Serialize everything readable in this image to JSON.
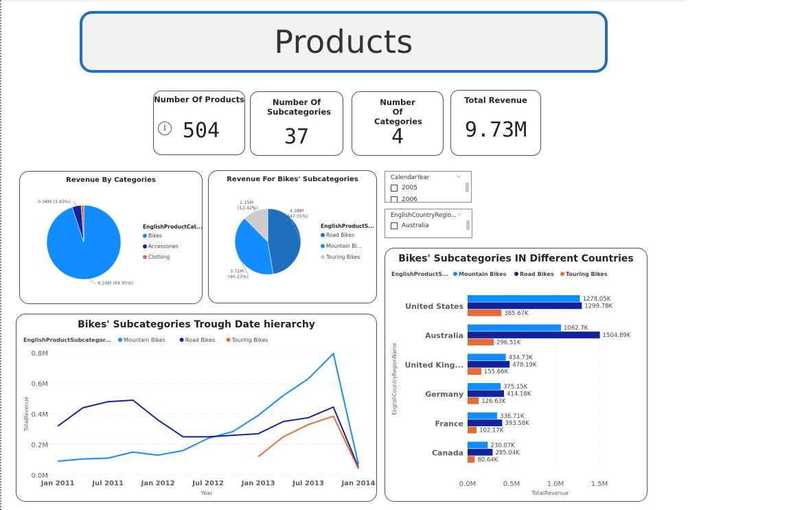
{
  "header": {
    "title": "Products"
  },
  "kpis": {
    "products": {
      "label": "Number Of Products",
      "value": "504"
    },
    "subcategories": {
      "label": "Number Of Subcategories",
      "value": "37"
    },
    "categories": {
      "label": "Number Of Categories",
      "value": "4"
    },
    "revenue": {
      "label": "Total Revenue",
      "value": "9.73M"
    }
  },
  "slicers": {
    "year": {
      "header": "CalendarYear",
      "items": [
        "2005",
        "2006"
      ]
    },
    "country": {
      "header": "EnglishCountryRegio...",
      "items": [
        "Australia"
      ]
    }
  },
  "colors": {
    "mountain": "#118DFF",
    "road": "#12239E",
    "touring": "#E66C37",
    "light_gray": "#CCCCCC",
    "border_blue": "#1F6FBF"
  },
  "chart_data": [
    {
      "type": "pie",
      "title": "Revenue By Categories",
      "legend_title": "EnglishProductCat...",
      "legend_position": "right",
      "labels": [
        "Bikes",
        "Accessories",
        "Clothing"
      ],
      "values": [
        9.24,
        0.38,
        0.11
      ],
      "colors": [
        "#118DFF",
        "#12239E",
        "#E66C37"
      ],
      "data_labels": [
        "9.24M (94.95%)",
        "0.38M (3.93%)",
        ""
      ]
    },
    {
      "type": "pie",
      "title": "Revenue For Bikes' Subcategories",
      "legend_title": "EnglishProductS...",
      "legend_position": "right",
      "labels": [
        "Road Bikes",
        "Mountain Bi...",
        "Touring Bikes"
      ],
      "values": [
        4.38,
        3.72,
        1.15
      ],
      "colors": [
        "#1F6FBF",
        "#118DFF",
        "#CCCCCC"
      ],
      "data_labels": [
        [
          "4.38M",
          "(47.35%)"
        ],
        [
          "3.72M",
          "(40.23%)"
        ],
        [
          "1.15M",
          "(12.42%)"
        ]
      ]
    },
    {
      "type": "line",
      "title": "Bikes' Subcategories Trough Date hierarchy",
      "legend_title": "EnglishProductSubcategor...",
      "xlabel": "Year",
      "ylabel": "TotalRevenue",
      "x_ticks": [
        "Jan 2011",
        "Jul 2011",
        "Jan 2012",
        "Jul 2012",
        "Jan 2013",
        "Jul 2013",
        "Jan 2014"
      ],
      "y_ticks": [
        "0.0M",
        "0.2M",
        "0.4M",
        "0.6M",
        "0.8M"
      ],
      "ylim": [
        0,
        0.8
      ],
      "grid": true,
      "x_months": [
        "2010-12",
        "2011-01",
        "2011-02",
        "2011-03",
        "2011-04",
        "2011-05",
        "2011-06",
        "2011-07",
        "2011-08",
        "2011-09",
        "2011-10",
        "2011-11",
        "2011-12",
        "2012-01",
        "2012-02",
        "2012-03",
        "2012-04",
        "2012-05",
        "2012-06",
        "2012-07",
        "2012-08",
        "2012-09",
        "2012-10",
        "2012-11",
        "2012-12",
        "2013-01",
        "2013-02",
        "2013-03",
        "2013-04",
        "2013-05",
        "2013-06",
        "2013-07",
        "2013-08",
        "2013-09",
        "2013-10",
        "2013-11",
        "2013-12",
        "2014-01"
      ],
      "series": [
        {
          "name": "Mountain Bikes",
          "color": "#118DFF",
          "points": [
            [
              "2011-01",
              0.09
            ],
            [
              "2011-04",
              0.105
            ],
            [
              "2011-07",
              0.11
            ],
            [
              "2011-10",
              0.15
            ],
            [
              "2012-01",
              0.13
            ],
            [
              "2012-04",
              0.16
            ],
            [
              "2012-07",
              0.24
            ],
            [
              "2012-10",
              0.285
            ],
            [
              "2013-01",
              0.39
            ],
            [
              "2013-04",
              0.52
            ],
            [
              "2013-07",
              0.63
            ],
            [
              "2013-10",
              0.795
            ],
            [
              "2014-01",
              0.07
            ]
          ]
        },
        {
          "name": "Road Bikes",
          "color": "#12239E",
          "points": [
            [
              "2011-01",
              0.32
            ],
            [
              "2011-04",
              0.44
            ],
            [
              "2011-07",
              0.48
            ],
            [
              "2011-10",
              0.49
            ],
            [
              "2012-01",
              0.36
            ],
            [
              "2012-04",
              0.25
            ],
            [
              "2012-07",
              0.25
            ],
            [
              "2012-10",
              0.26
            ],
            [
              "2013-01",
              0.27
            ],
            [
              "2013-04",
              0.35
            ],
            [
              "2013-07",
              0.375
            ],
            [
              "2013-10",
              0.445
            ],
            [
              "2014-01",
              0.05
            ]
          ]
        },
        {
          "name": "Touring Bikes",
          "color": "#E66C37",
          "points": [
            [
              "2013-01",
              0.12
            ],
            [
              "2013-04",
              0.25
            ],
            [
              "2013-07",
              0.33
            ],
            [
              "2013-10",
              0.385
            ],
            [
              "2014-01",
              0.04
            ]
          ]
        }
      ]
    },
    {
      "type": "bar",
      "orientation": "horizontal",
      "title": "Bikes' Subcategories IN Different Countries",
      "legend_title": "EnglishProductS...",
      "xlabel": "TotalRevenue",
      "ylabel": "EnglishCountryRegionName",
      "x_ticks": [
        "0.0M",
        "0.5M",
        "1.0M",
        "1.5M"
      ],
      "xlim": [
        0,
        1.5
      ],
      "grid": true,
      "categories": [
        "United States",
        "Australia",
        "United King...",
        "Germany",
        "France",
        "Canada"
      ],
      "series": [
        {
          "name": "Mountain Bikes",
          "color": "#118DFF",
          "values": [
            1.27805,
            1.0627,
            0.43473,
            0.37515,
            0.33671,
            0.23007
          ],
          "labels": [
            "1278.05K",
            "1062.7K",
            "434.73K",
            "375.15K",
            "336.71K",
            "230.07K"
          ]
        },
        {
          "name": "Road Bikes",
          "color": "#12239E",
          "values": [
            1.29978,
            1.50489,
            0.47819,
            0.41418,
            0.39358,
            0.28504
          ],
          "labels": [
            "1299.78K",
            "1504.89K",
            "478.19K",
            "414.18K",
            "393.58K",
            "285.04K"
          ]
        },
        {
          "name": "Touring Bikes",
          "color": "#E66C37",
          "values": [
            0.38567,
            0.29651,
            0.15566,
            0.12663,
            0.10217,
            0.08064
          ],
          "labels": [
            "385.67K",
            "296.51K",
            "155.66K",
            "126.63K",
            "102.17K",
            "80.64K"
          ]
        }
      ]
    }
  ]
}
